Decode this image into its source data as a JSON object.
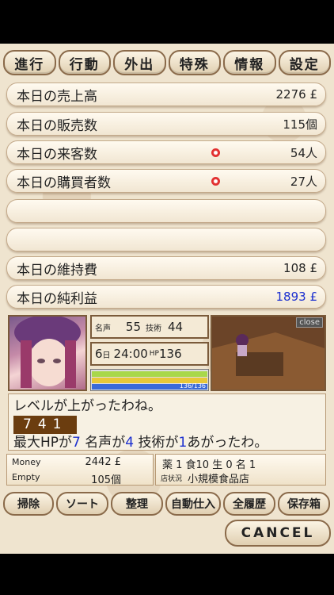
{
  "tabs": [
    "進行",
    "行動",
    "外出",
    "特殊",
    "情報",
    "設定"
  ],
  "rows": [
    {
      "label": "本日の売上高",
      "value": "2276 £"
    },
    {
      "label": "本日の販売数",
      "value": "115個"
    },
    {
      "label": "本日の来客数",
      "value": "54人"
    },
    {
      "label": "本日の購買者数",
      "value": "27人"
    },
    {
      "label": "",
      "value": ""
    },
    {
      "label": "",
      "value": ""
    },
    {
      "label": "本日の維持費",
      "value": "108 £"
    },
    {
      "label": "本日の純利益",
      "value": "1893 £"
    }
  ],
  "stats": {
    "fame_label": "名声",
    "fame": "55",
    "skill_label": "技術",
    "skill": "44",
    "day": "6",
    "day_unit": "日",
    "time": "24:00",
    "hp_label": "HP",
    "hp": "136",
    "hp_bar_text": "136/136",
    "hp_fill": 1.0
  },
  "room": {
    "close_label": "close"
  },
  "message": {
    "line1": "レベルが上がったわね。",
    "number": "741",
    "line3_a": "最大HPが",
    "hp_up": "7",
    "line3_b": " 名声が",
    "fame_up": "4",
    "line3_c": " 技術が",
    "skill_up": "1",
    "line3_d": "あがったわ。"
  },
  "info_left": {
    "money_label": "Money",
    "money": "2442 £",
    "empty_label": "Empty",
    "empty": "105個"
  },
  "info_right": {
    "line1": "薬 1 食10 生 0 名 1",
    "shop_label": "店状況",
    "shop": "小規模食品店"
  },
  "bottom_buttons": [
    "掃除",
    "ソート",
    "整理",
    "自動仕入",
    "全履歴",
    "保存箱"
  ],
  "cancel_label": "CANCEL",
  "colors": {
    "accent_blue": "#1b2fd0",
    "num_bg": "#6b3d0f"
  }
}
